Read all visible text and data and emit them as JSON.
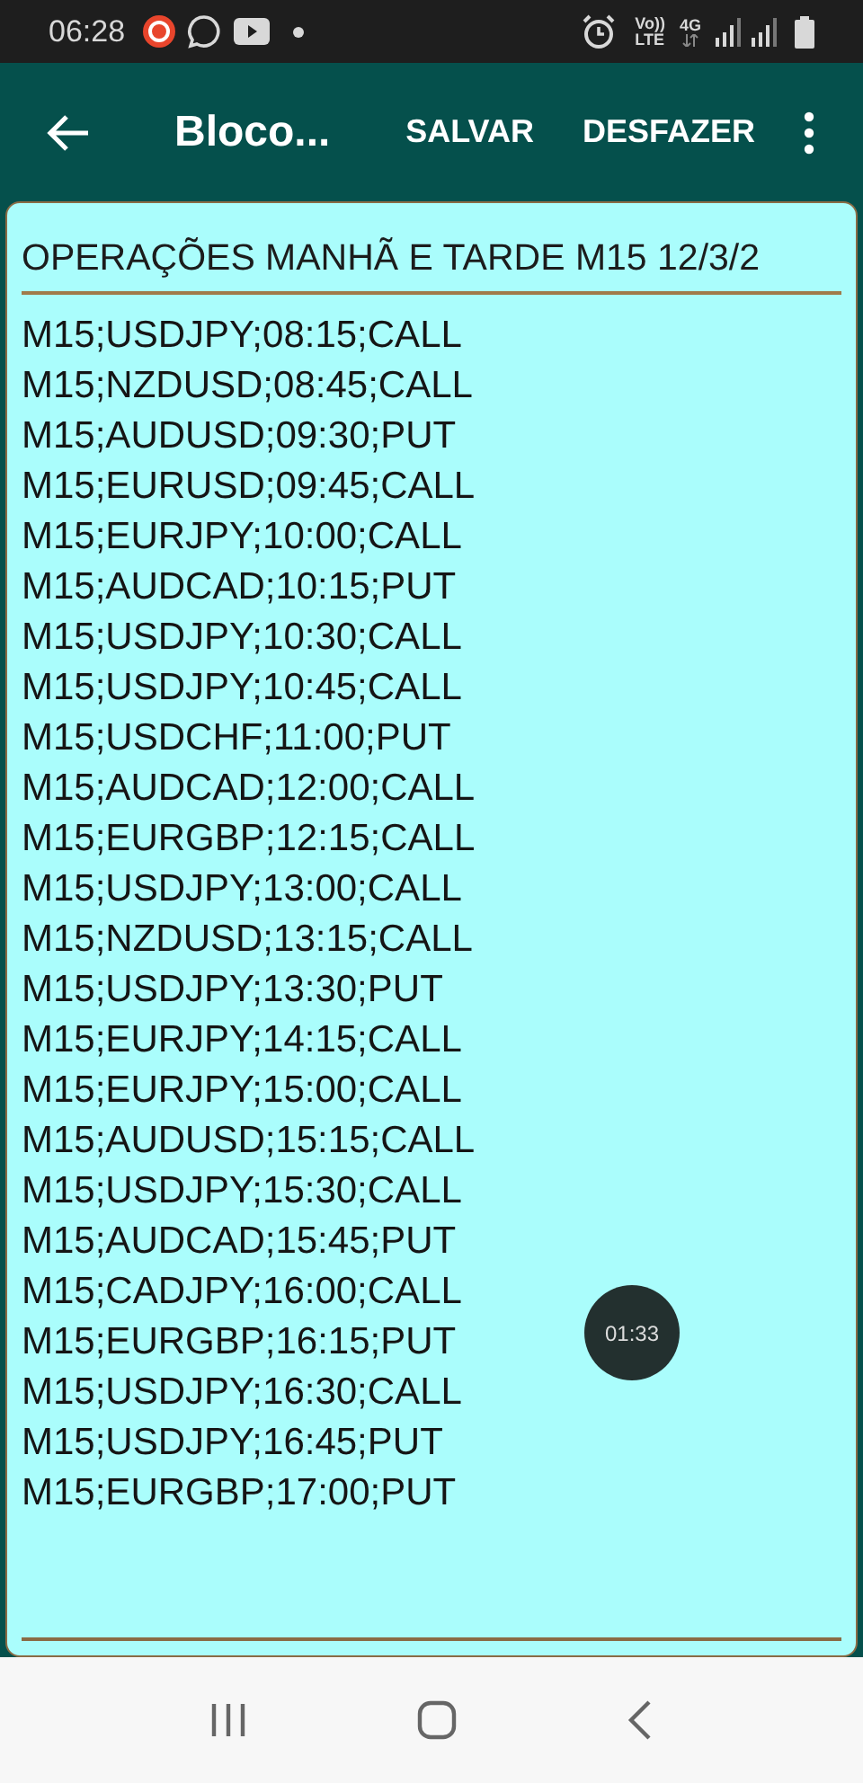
{
  "status_bar": {
    "time": "06:28",
    "volte": "Vo))",
    "lte": "LTE",
    "network": "4G"
  },
  "app_bar": {
    "title": "Bloco...",
    "actions": [
      "SALVAR",
      "DESFAZER"
    ]
  },
  "note": {
    "title": "OPERAÇÕES MANHÃ E TARDE M15 12/3/2",
    "lines": [
      "M15;USDJPY;08:15;CALL",
      "M15;NZDUSD;08:45;CALL",
      "M15;AUDUSD;09:30;PUT",
      "M15;EURUSD;09:45;CALL",
      "M15;EURJPY;10:00;CALL",
      "M15;AUDCAD;10:15;PUT",
      "M15;USDJPY;10:30;CALL",
      "M15;USDJPY;10:45;CALL",
      "M15;USDCHF;11:00;PUT",
      "M15;AUDCAD;12:00;CALL",
      "M15;EURGBP;12:15;CALL",
      "M15;USDJPY;13:00;CALL",
      "M15;NZDUSD;13:15;CALL",
      "M15;USDJPY;13:30;PUT",
      "M15;EURJPY;14:15;CALL",
      "M15;EURJPY;15:00;CALL",
      "M15;AUDUSD;15:15;CALL",
      "M15;USDJPY;15:30;CALL",
      "M15;AUDCAD;15:45;PUT",
      "M15;CADJPY;16:00;CALL",
      "M15;EURGBP;16:15;PUT",
      "M15;USDJPY;16:30;CALL",
      "M15;USDJPY;16:45;PUT",
      "M15;EURGBP;17:00;PUT"
    ]
  },
  "timer": "01:33"
}
